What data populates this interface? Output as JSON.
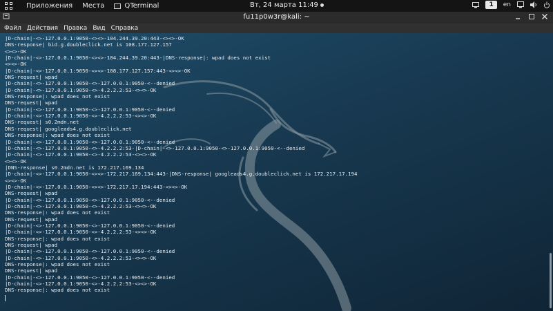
{
  "topbar": {
    "applications": "Приложения",
    "places": "Места",
    "active_app": "QTerminal",
    "clock": "Вт, 24 марта  11:49",
    "workspace": "1",
    "keyboard_layout": "en"
  },
  "window": {
    "title": "fu11p0w3r@kali: ~"
  },
  "menu": {
    "items": [
      "Файл",
      "Действия",
      "Правка",
      "Вид",
      "Справка"
    ]
  },
  "terminal": {
    "lines": [
      "|D-chain|-<>-127.0.0.1:9050-<><>-104.244.39.20:443-<><>-OK",
      "DNS-response| bid.g.doubleclick.net is 108.177.127.157",
      "<><>-OK",
      "|D-chain|-<>-127.0.0.1:9050-<><>-104.244.39.20:443-|DNS-response|: wpad does not exist",
      "<><>-OK",
      "|D-chain|-<>-127.0.0.1:9050-<><>-108.177.127.157:443-<><>-OK",
      "DNS-request| wpad",
      "|D-chain|-<>-127.0.0.1:9050-<>-127.0.0.1:9050-<--denied",
      "|D-chain|-<>-127.0.0.1:9050-<>-4.2.2.2:53-<><>-OK",
      "DNS-response|: wpad does not exist",
      "DNS-request| wpad",
      "|D-chain|-<>-127.0.0.1:9050-<>-127.0.0.1:9050-<--denied",
      "|D-chain|-<>-127.0.0.1:9050-<>-4.2.2.2:53-<><>-OK",
      "DNS-request| s0.2mdn.net",
      "DNS-request| googleads4.g.doubleclick.net",
      "DNS-response|: wpad does not exist",
      "|D-chain|-<>-127.0.0.1:9050-<>-127.0.0.1:9050-<--denied",
      "|D-chain|-<>-127.0.0.1:9050-<>-4.2.2.2:53-|D-chain|-<>-127.0.0.1:9050-<>-127.0.0.1:9050-<--denied",
      "|D-chain|-<>-127.0.0.1:9050-<>-4.2.2.2:53-<><>-OK",
      "<><>-OK",
      "|DNS-response| s0.2mdn.net is 172.217.169.134",
      "|D-chain|-<>-127.0.0.1:9050-<><>-172.217.169.134:443-|DNS-response| googleads4.g.doubleclick.net is 172.217.17.194",
      "<><>-OK",
      "|D-chain|-<>-127.0.0.1:9050-<><>-172.217.17.194:443-<><>-OK",
      "DNS-request| wpad",
      "|D-chain|-<>-127.0.0.1:9050-<>-127.0.0.1:9050-<--denied",
      "|D-chain|-<>-127.0.0.1:9050-<>-4.2.2.2:53-<><>-OK",
      "DNS-response|: wpad does not exist",
      "DNS-request| wpad",
      "|D-chain|-<>-127.0.0.1:9050-<>-127.0.0.1:9050-<--denied",
      "|D-chain|-<>-127.0.0.1:9050-<>-4.2.2.2:53-<><>-OK",
      "DNS-response|: wpad does not exist",
      "DNS-request| wpad",
      "|D-chain|-<>-127.0.0.1:9050-<>-127.0.0.1:9050-<--denied",
      "|D-chain|-<>-127.0.0.1:9050-<>-4.2.2.2:53-<><>-OK",
      "DNS-response|: wpad does not exist",
      "DNS-request| wpad",
      "|D-chain|-<>-127.0.0.1:9050-<>-127.0.0.1:9050-<--denied",
      "|D-chain|-<>-127.0.0.1:9050-<>-4.2.2.2:53-<><>-OK",
      "DNS-response|: wpad does not exist"
    ]
  }
}
